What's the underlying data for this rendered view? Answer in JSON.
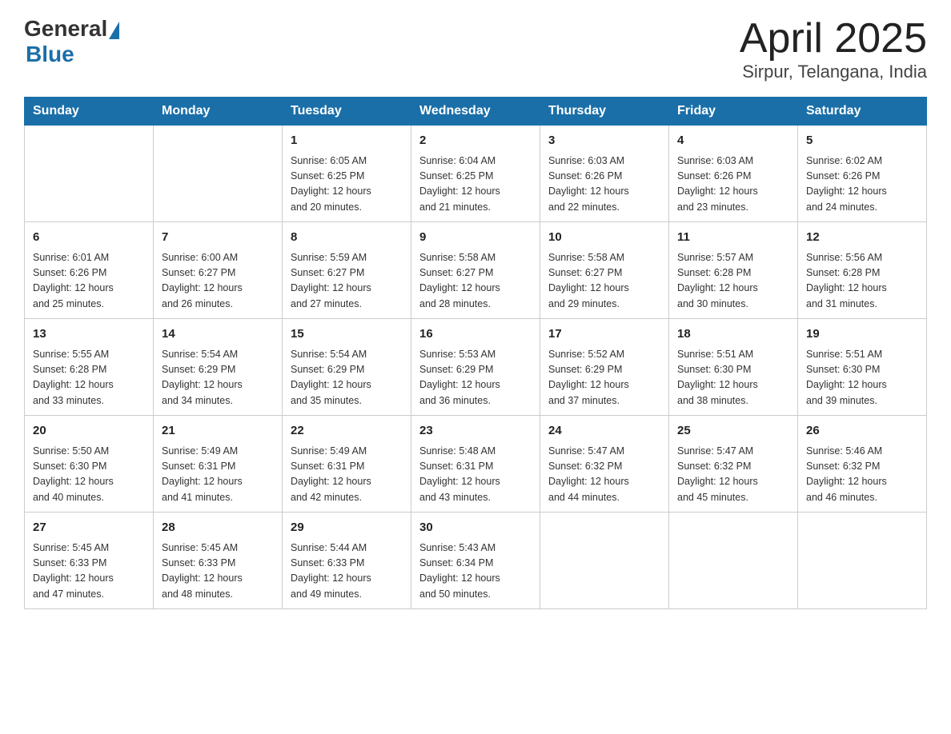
{
  "header": {
    "logo": {
      "general": "General",
      "triangle": "▶",
      "blue": "Blue"
    },
    "title": "April 2025",
    "subtitle": "Sirpur, Telangana, India"
  },
  "weekdays": [
    "Sunday",
    "Monday",
    "Tuesday",
    "Wednesday",
    "Thursday",
    "Friday",
    "Saturday"
  ],
  "weeks": [
    [
      {
        "day": "",
        "info": ""
      },
      {
        "day": "",
        "info": ""
      },
      {
        "day": "1",
        "info": "Sunrise: 6:05 AM\nSunset: 6:25 PM\nDaylight: 12 hours\nand 20 minutes."
      },
      {
        "day": "2",
        "info": "Sunrise: 6:04 AM\nSunset: 6:25 PM\nDaylight: 12 hours\nand 21 minutes."
      },
      {
        "day": "3",
        "info": "Sunrise: 6:03 AM\nSunset: 6:26 PM\nDaylight: 12 hours\nand 22 minutes."
      },
      {
        "day": "4",
        "info": "Sunrise: 6:03 AM\nSunset: 6:26 PM\nDaylight: 12 hours\nand 23 minutes."
      },
      {
        "day": "5",
        "info": "Sunrise: 6:02 AM\nSunset: 6:26 PM\nDaylight: 12 hours\nand 24 minutes."
      }
    ],
    [
      {
        "day": "6",
        "info": "Sunrise: 6:01 AM\nSunset: 6:26 PM\nDaylight: 12 hours\nand 25 minutes."
      },
      {
        "day": "7",
        "info": "Sunrise: 6:00 AM\nSunset: 6:27 PM\nDaylight: 12 hours\nand 26 minutes."
      },
      {
        "day": "8",
        "info": "Sunrise: 5:59 AM\nSunset: 6:27 PM\nDaylight: 12 hours\nand 27 minutes."
      },
      {
        "day": "9",
        "info": "Sunrise: 5:58 AM\nSunset: 6:27 PM\nDaylight: 12 hours\nand 28 minutes."
      },
      {
        "day": "10",
        "info": "Sunrise: 5:58 AM\nSunset: 6:27 PM\nDaylight: 12 hours\nand 29 minutes."
      },
      {
        "day": "11",
        "info": "Sunrise: 5:57 AM\nSunset: 6:28 PM\nDaylight: 12 hours\nand 30 minutes."
      },
      {
        "day": "12",
        "info": "Sunrise: 5:56 AM\nSunset: 6:28 PM\nDaylight: 12 hours\nand 31 minutes."
      }
    ],
    [
      {
        "day": "13",
        "info": "Sunrise: 5:55 AM\nSunset: 6:28 PM\nDaylight: 12 hours\nand 33 minutes."
      },
      {
        "day": "14",
        "info": "Sunrise: 5:54 AM\nSunset: 6:29 PM\nDaylight: 12 hours\nand 34 minutes."
      },
      {
        "day": "15",
        "info": "Sunrise: 5:54 AM\nSunset: 6:29 PM\nDaylight: 12 hours\nand 35 minutes."
      },
      {
        "day": "16",
        "info": "Sunrise: 5:53 AM\nSunset: 6:29 PM\nDaylight: 12 hours\nand 36 minutes."
      },
      {
        "day": "17",
        "info": "Sunrise: 5:52 AM\nSunset: 6:29 PM\nDaylight: 12 hours\nand 37 minutes."
      },
      {
        "day": "18",
        "info": "Sunrise: 5:51 AM\nSunset: 6:30 PM\nDaylight: 12 hours\nand 38 minutes."
      },
      {
        "day": "19",
        "info": "Sunrise: 5:51 AM\nSunset: 6:30 PM\nDaylight: 12 hours\nand 39 minutes."
      }
    ],
    [
      {
        "day": "20",
        "info": "Sunrise: 5:50 AM\nSunset: 6:30 PM\nDaylight: 12 hours\nand 40 minutes."
      },
      {
        "day": "21",
        "info": "Sunrise: 5:49 AM\nSunset: 6:31 PM\nDaylight: 12 hours\nand 41 minutes."
      },
      {
        "day": "22",
        "info": "Sunrise: 5:49 AM\nSunset: 6:31 PM\nDaylight: 12 hours\nand 42 minutes."
      },
      {
        "day": "23",
        "info": "Sunrise: 5:48 AM\nSunset: 6:31 PM\nDaylight: 12 hours\nand 43 minutes."
      },
      {
        "day": "24",
        "info": "Sunrise: 5:47 AM\nSunset: 6:32 PM\nDaylight: 12 hours\nand 44 minutes."
      },
      {
        "day": "25",
        "info": "Sunrise: 5:47 AM\nSunset: 6:32 PM\nDaylight: 12 hours\nand 45 minutes."
      },
      {
        "day": "26",
        "info": "Sunrise: 5:46 AM\nSunset: 6:32 PM\nDaylight: 12 hours\nand 46 minutes."
      }
    ],
    [
      {
        "day": "27",
        "info": "Sunrise: 5:45 AM\nSunset: 6:33 PM\nDaylight: 12 hours\nand 47 minutes."
      },
      {
        "day": "28",
        "info": "Sunrise: 5:45 AM\nSunset: 6:33 PM\nDaylight: 12 hours\nand 48 minutes."
      },
      {
        "day": "29",
        "info": "Sunrise: 5:44 AM\nSunset: 6:33 PM\nDaylight: 12 hours\nand 49 minutes."
      },
      {
        "day": "30",
        "info": "Sunrise: 5:43 AM\nSunset: 6:34 PM\nDaylight: 12 hours\nand 50 minutes."
      },
      {
        "day": "",
        "info": ""
      },
      {
        "day": "",
        "info": ""
      },
      {
        "day": "",
        "info": ""
      }
    ]
  ]
}
